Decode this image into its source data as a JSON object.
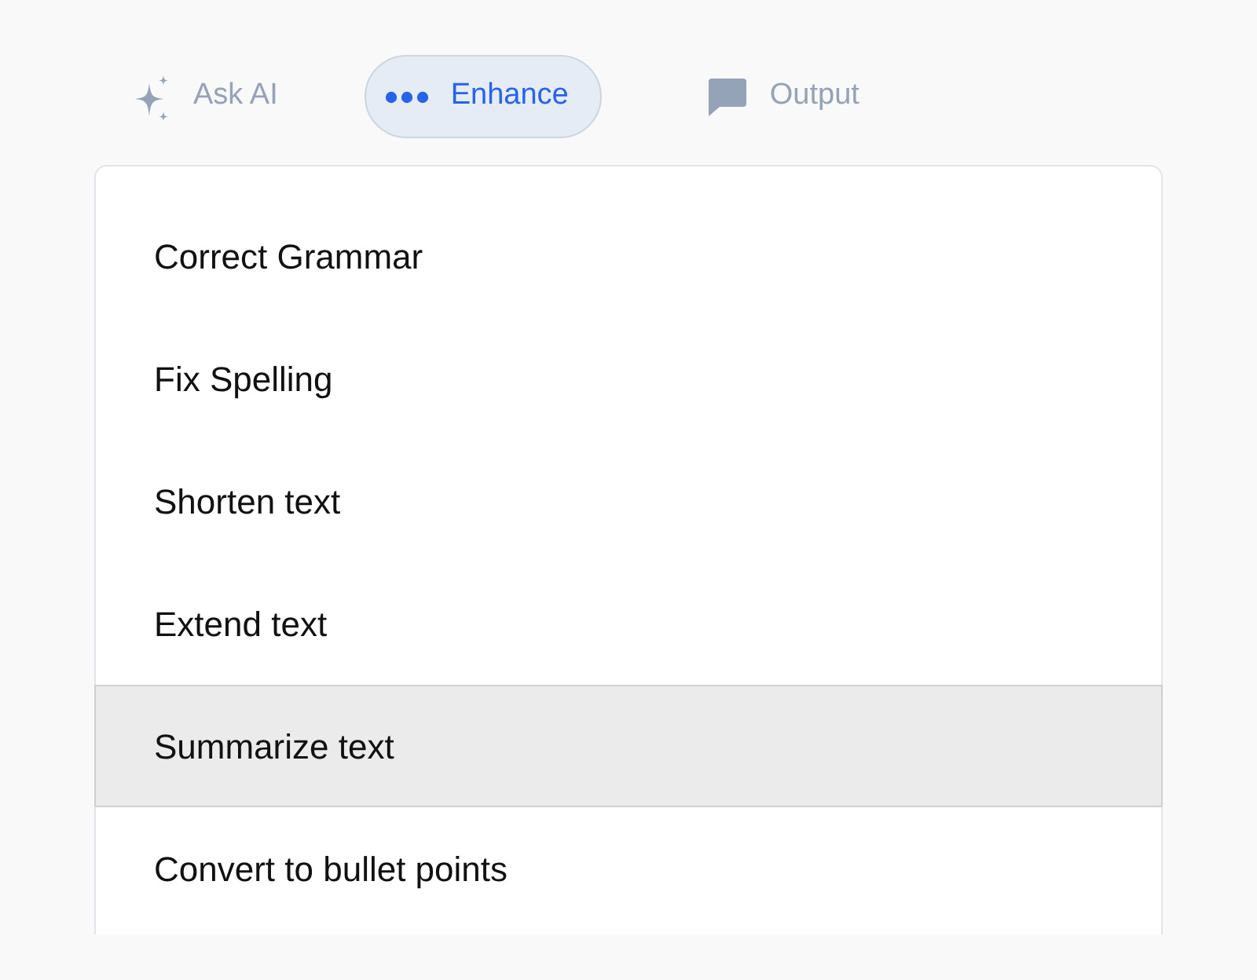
{
  "tabs": [
    {
      "label": "Ask AI",
      "kind": "sparkle",
      "selected": false
    },
    {
      "label": "Enhance",
      "kind": "dots",
      "selected": true
    },
    {
      "label": "Output",
      "kind": "chat",
      "selected": false
    }
  ],
  "menu": {
    "items": [
      {
        "label": "Correct Grammar",
        "selected": false
      },
      {
        "label": "Fix Spelling",
        "selected": false
      },
      {
        "label": "Shorten text",
        "selected": false
      },
      {
        "label": "Extend text",
        "selected": false
      },
      {
        "label": "Summarize text",
        "selected": true
      },
      {
        "label": "Convert to bullet points",
        "selected": false
      }
    ]
  }
}
